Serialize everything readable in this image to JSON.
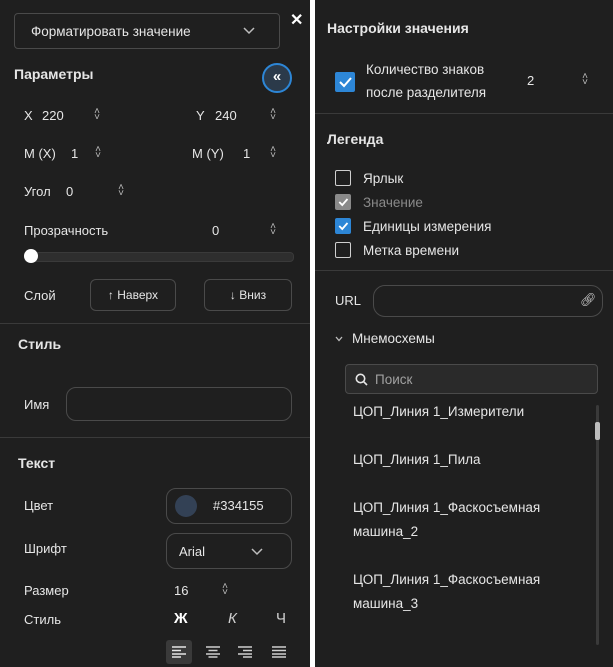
{
  "left": {
    "format_dropdown": "Форматировать значение",
    "params_title": "Параметры",
    "x_label": "X",
    "x_value": "220",
    "y_label": "Y",
    "y_value": "240",
    "mx_label": "M (X)",
    "mx_value": "1",
    "my_label": "M (Y)",
    "my_value": "1",
    "angle_label": "Угол",
    "angle_value": "0",
    "opacity_label": "Прозрачность",
    "opacity_value": "0",
    "opacity_level": 0,
    "layer_label": "Слой",
    "layer_up": "↑ Наверх",
    "layer_down": "↓ Вниз",
    "style_title": "Стиль",
    "name_label": "Имя",
    "name_value": "",
    "text_title": "Текст",
    "color_label": "Цвет",
    "color_value": "#334155",
    "font_label": "Шрифт",
    "font_value": "Arial",
    "size_label": "Размер",
    "size_value": "16",
    "style_label": "Стиль",
    "bold_btn": "Ж",
    "italic_btn": "К",
    "underline_btn": "Ч"
  },
  "right": {
    "value_settings_title": "Настройки значения",
    "decimals_label_1": "Количество знаков",
    "decimals_label_2": "после разделителя",
    "decimals_value": "2",
    "legend_title": "Легенда",
    "legend_items": [
      {
        "label": "Ярлык",
        "checked": false,
        "disabled": false
      },
      {
        "label": "Значение",
        "checked": true,
        "disabled": true
      },
      {
        "label": "Единицы измерения",
        "checked": true,
        "disabled": false
      },
      {
        "label": "Метка времени",
        "checked": false,
        "disabled": false
      }
    ],
    "url_label": "URL",
    "url_value": "",
    "mnemo_title": "Мнемосхемы",
    "search_placeholder": "Поиск",
    "mnemo_items": [
      "ЦОП_Линия 1_Измерители",
      "ЦОП_Линия 1_Пила",
      "ЦОП_Линия 1_Фаскосъемная машина_2",
      "ЦОП_Линия 1_Фаскосъемная машина_3"
    ]
  },
  "colors": {
    "panel_bg": "#1f1f1f",
    "accent": "#2d86d6",
    "swatch": "#334155"
  },
  "icons": [
    "close-icon",
    "chevron-down-icon",
    "collapse-icon",
    "stepper-icon",
    "link-icon",
    "search-icon",
    "align-left-icon",
    "align-center-icon",
    "align-right-icon",
    "align-justify-icon"
  ]
}
